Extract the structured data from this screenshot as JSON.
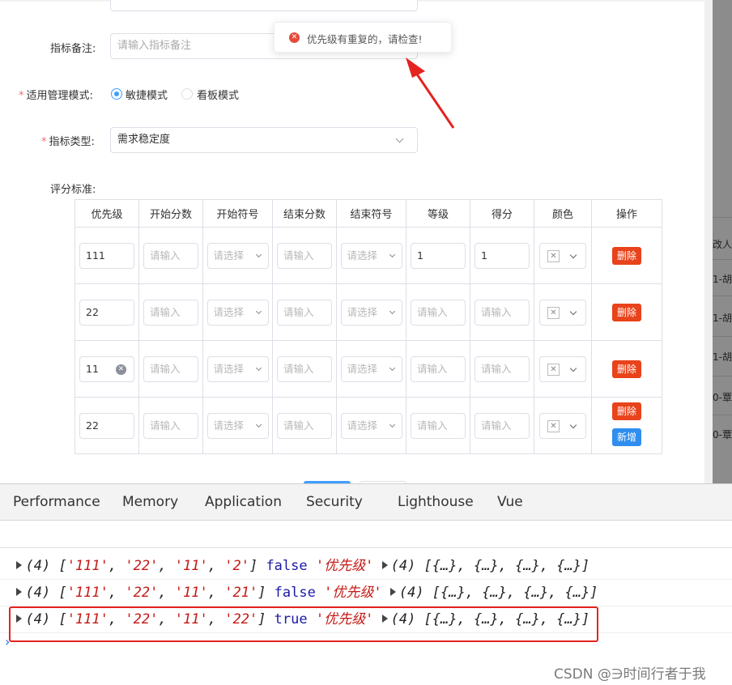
{
  "form": {
    "remark_label": "指标备注:",
    "remark_placeholder": "请输入指标备注",
    "mode_label": "适用管理模式:",
    "mode_options": [
      "敏捷模式",
      "看板模式"
    ],
    "mode_selected": "敏捷模式",
    "type_label": "指标类型:",
    "type_value": "需求稳定度",
    "criteria_label": "评分标准:",
    "required_mark": "*"
  },
  "toast": {
    "message": "优先级有重复的，请检查!",
    "icon": "error-circle-icon"
  },
  "table": {
    "headers": [
      "优先级",
      "开始分数",
      "开始符号",
      "结束分数",
      "结束符号",
      "等级",
      "得分",
      "颜色",
      "操作"
    ],
    "input_placeholder": "请输入",
    "select_placeholder": "请选择",
    "delete_label": "删除",
    "add_label": "新增",
    "rows": [
      {
        "priority": "111",
        "level": "1",
        "score": "1",
        "clearable": false
      },
      {
        "priority": "22",
        "level": "",
        "score": "",
        "clearable": false
      },
      {
        "priority": "11",
        "level": "",
        "score": "",
        "clearable": true
      },
      {
        "priority": "22",
        "level": "",
        "score": "",
        "clearable": false
      }
    ]
  },
  "background": {
    "column_header_partial": "改人",
    "cells_partial": [
      "1-胡",
      "1-胡",
      "1-胡",
      "0-覃",
      "0-覃"
    ]
  },
  "devtools": {
    "tabs": [
      "Performance",
      "Memory",
      "Application",
      "Security",
      "Lighthouse",
      "Vue"
    ],
    "logs": [
      {
        "count": "(4)",
        "arr": [
          "'111'",
          "'22'",
          "'11'",
          "'2'"
        ],
        "bool": "false",
        "str": "'优先级'",
        "objs": "(4) [{…}, {…}, {…}, {…}]"
      },
      {
        "count": "(4)",
        "arr": [
          "'111'",
          "'22'",
          "'11'",
          "'21'"
        ],
        "bool": "false",
        "str": "'优先级'",
        "objs": "(4) [{…}, {…}, {…}, {…}]"
      },
      {
        "count": "(4)",
        "arr": [
          "'111'",
          "'22'",
          "'11'",
          "'22'"
        ],
        "bool": "true",
        "str": "'优先级'",
        "objs": "(4) [{…}, {…}, {…}, {…}]"
      }
    ],
    "prompt": "›"
  },
  "watermark": "CSDN @∋时间行者于我",
  "colors": {
    "accent": "#409eff",
    "danger": "#e8431b",
    "annotation": "#e5231f"
  }
}
